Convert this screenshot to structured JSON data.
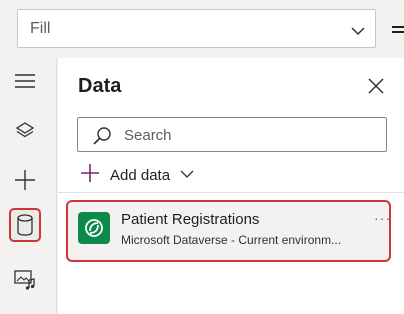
{
  "property_bar": {
    "selected_property": "Fill"
  },
  "rail": {
    "items": [
      {
        "name": "menu"
      },
      {
        "name": "tree-view"
      },
      {
        "name": "insert"
      },
      {
        "name": "data"
      },
      {
        "name": "media"
      }
    ]
  },
  "panel": {
    "title": "Data",
    "search_placeholder": "Search",
    "add_data_label": "Add data",
    "data_sources": [
      {
        "name": "Patient Registrations",
        "subtitle": "Microsoft Dataverse - Current environm...",
        "more_label": "···"
      }
    ]
  },
  "colors": {
    "highlight": "#d13438",
    "dataverse_green": "#0b8a4a"
  }
}
